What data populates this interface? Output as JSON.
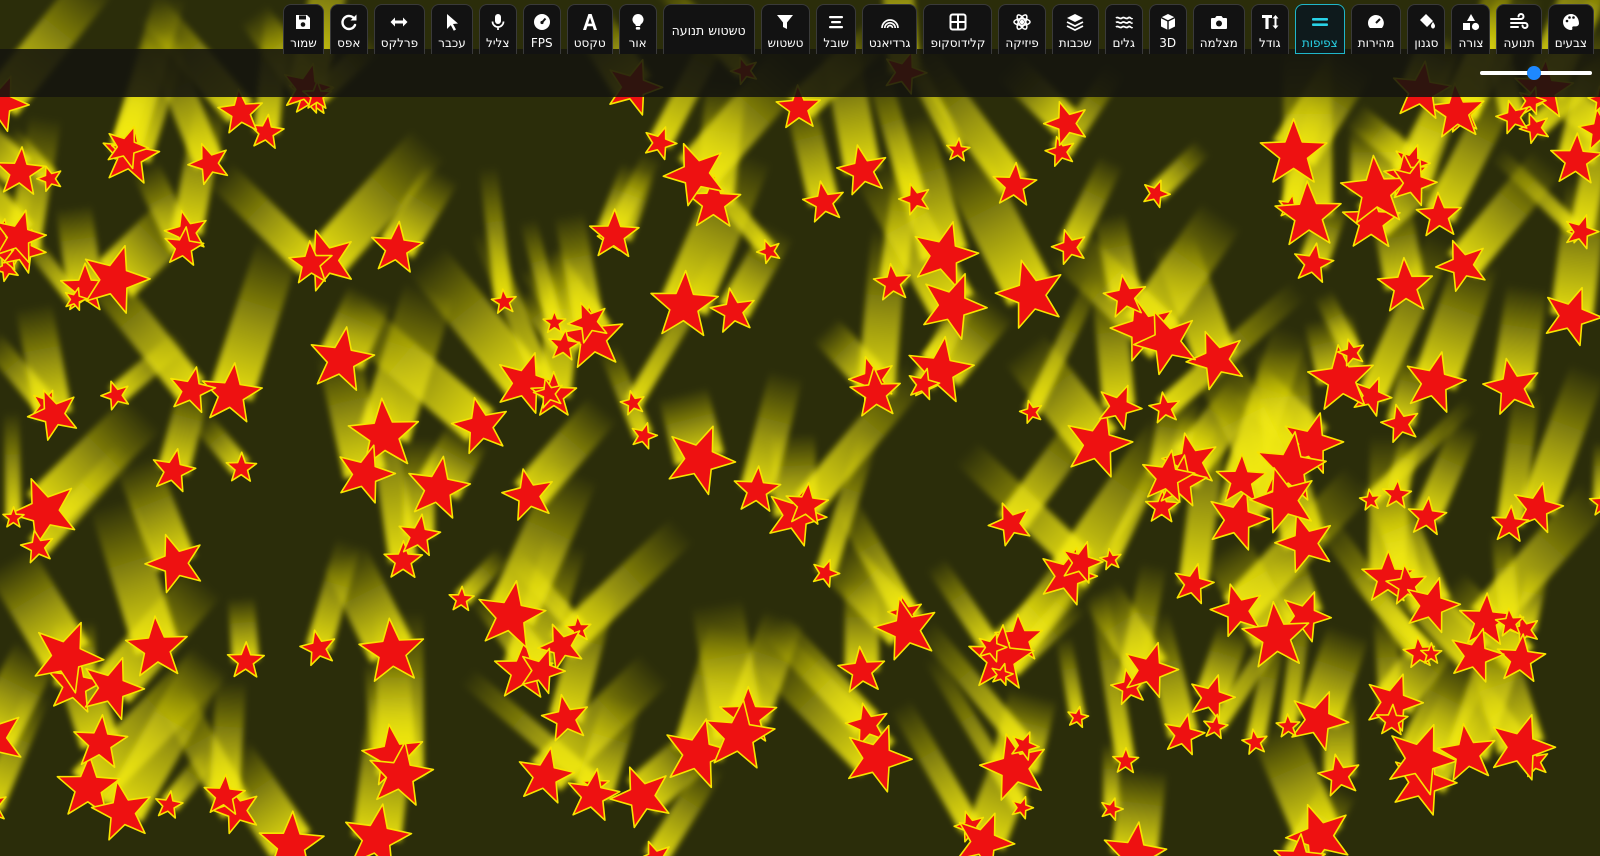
{
  "toolbar": {
    "items": [
      {
        "id": "colors",
        "label": "צבעים",
        "icon": "palette-icon",
        "active": false
      },
      {
        "id": "motion",
        "label": "תנועה",
        "icon": "wind-icon",
        "active": false
      },
      {
        "id": "shape",
        "label": "צורה",
        "icon": "shapes-icon",
        "active": false
      },
      {
        "id": "style",
        "label": "סגנון",
        "icon": "paint-bucket-icon",
        "active": false
      },
      {
        "id": "speed",
        "label": "מהירות",
        "icon": "speedometer-icon",
        "active": false
      },
      {
        "id": "density",
        "label": "צפיפות",
        "icon": "equals-icon",
        "active": true
      },
      {
        "id": "size",
        "label": "גודל",
        "icon": "text-height-icon",
        "active": false
      },
      {
        "id": "camera",
        "label": "מצלמה",
        "icon": "camera-icon",
        "active": false
      },
      {
        "id": "3d",
        "label": "3D",
        "icon": "cube-icon",
        "active": false
      },
      {
        "id": "waves",
        "label": "גלים",
        "icon": "waves-icon",
        "active": false
      },
      {
        "id": "layers",
        "label": "שכבות",
        "icon": "layers-icon",
        "active": false
      },
      {
        "id": "physics",
        "label": "פיזיקה",
        "icon": "atom-icon",
        "active": false
      },
      {
        "id": "kaleidoscope",
        "label": "קלידוסקופ",
        "icon": "grid-icon",
        "active": false
      },
      {
        "id": "gradient",
        "label": "גרדיאנט",
        "icon": "rainbow-icon",
        "active": false
      },
      {
        "id": "trail",
        "label": "שובל",
        "icon": "lines-icon",
        "active": false
      },
      {
        "id": "blur",
        "label": "טשטוש",
        "icon": "filter-icon",
        "active": false
      },
      {
        "id": "motion-blur",
        "label": "טשטוש תנועה",
        "icon": "",
        "active": false
      },
      {
        "id": "light",
        "label": "אור",
        "icon": "lightbulb-icon",
        "active": false
      },
      {
        "id": "text",
        "label": "טקסט",
        "icon": "font-icon",
        "active": false
      },
      {
        "id": "fps",
        "label": "FPS",
        "icon": "gauge-icon",
        "active": false
      },
      {
        "id": "audio",
        "label": "צליל",
        "icon": "microphone-icon",
        "active": false
      },
      {
        "id": "cursor",
        "label": "עכבר",
        "icon": "pointer-icon",
        "active": false
      },
      {
        "id": "parallax",
        "label": "פרלקס",
        "icon": "arrows-horizontal-icon",
        "active": false
      },
      {
        "id": "reset",
        "label": "אפס",
        "icon": "redo-icon",
        "active": false
      },
      {
        "id": "save",
        "label": "שמור",
        "icon": "save-icon",
        "active": false
      }
    ]
  },
  "density_slider": {
    "value": 0.48
  },
  "colors": {
    "background": "#2b2d0a",
    "star_fill": "#ee1111",
    "star_outline": "#f7e400",
    "trail_color": "#f2ea10",
    "accent": "#29d2e6",
    "slider_thumb": "#1e88ff"
  }
}
